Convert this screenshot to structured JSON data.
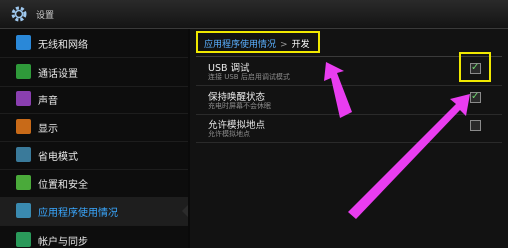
{
  "window": {
    "title": "设置"
  },
  "sidebar": {
    "items": [
      {
        "label": "无线和网络",
        "icon": "wifi-icon",
        "color": "#2a88d8"
      },
      {
        "label": "通话设置",
        "icon": "phone-icon",
        "color": "#2f9a3a"
      },
      {
        "label": "声音",
        "icon": "speaker-icon",
        "color": "#8a3fb0"
      },
      {
        "label": "显示",
        "icon": "display-icon",
        "color": "#c86a18"
      },
      {
        "label": "省电模式",
        "icon": "battery-icon",
        "color": "#3a7a9a"
      },
      {
        "label": "位置和安全",
        "icon": "grid-icon",
        "color": "#4aaa3a"
      },
      {
        "label": "应用程序使用情况",
        "icon": "apps-icon",
        "color": "#3a8ab0",
        "selected": true
      },
      {
        "label": "帐户与同步",
        "icon": "sync-icon",
        "color": "#2a9a5a"
      }
    ]
  },
  "breadcrumb": {
    "parent": "应用程序使用情况",
    "separator": ">",
    "current": "开发"
  },
  "settings": [
    {
      "title": "USB 调试",
      "subtitle": "连接 USB 后启用调试模式",
      "checked": true
    },
    {
      "title": "保持唤醒状态",
      "subtitle": "充电时屏幕不会休眠",
      "checked": true
    },
    {
      "title": "允许模拟地点",
      "subtitle": "允许模拟地点",
      "checked": false
    }
  ],
  "colors": {
    "accent": "#3aa8ff",
    "highlight": "#f0e800",
    "arrow": "#e93df0"
  }
}
